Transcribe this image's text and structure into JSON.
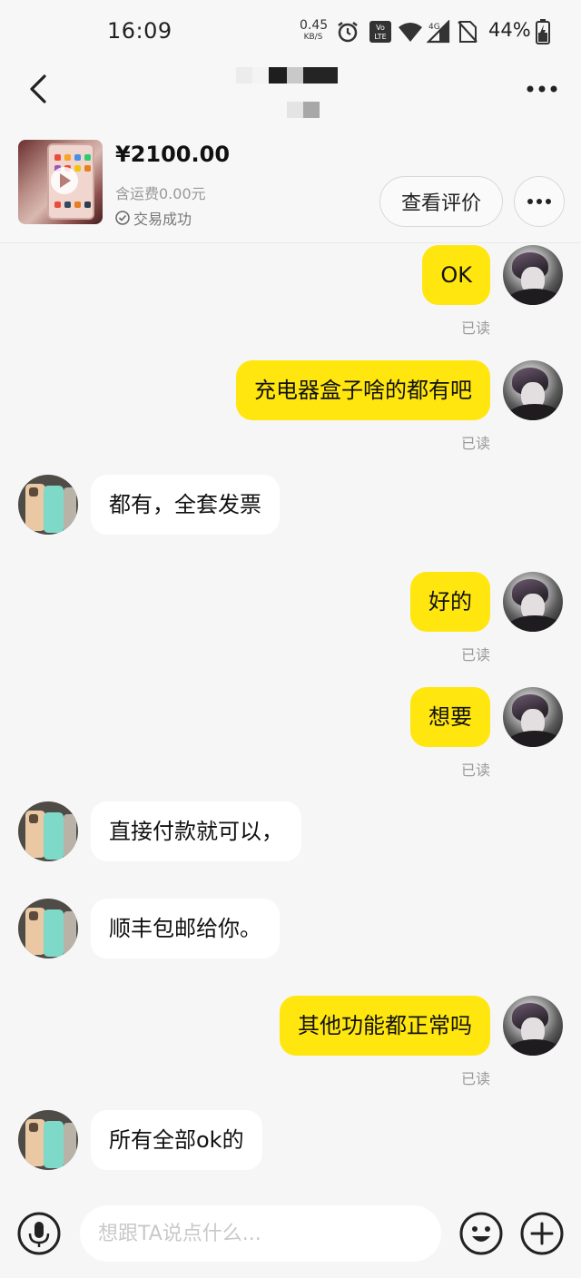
{
  "status_bar": {
    "time": "16:09",
    "net_speed": "0.45",
    "net_unit": "KB/S",
    "volte": "Vo LTE",
    "signal_label": "4G",
    "battery_percent": "44%"
  },
  "header": {
    "back_icon": "chevron-left-icon",
    "more_icon": "ellipsis-icon"
  },
  "product": {
    "price": "¥2100.00",
    "shipping": "含运费0.00元",
    "status": "交易成功",
    "review_button": "查看评价"
  },
  "messages": [
    {
      "side": "me",
      "text": "OK",
      "read": "已读"
    },
    {
      "side": "me",
      "text": "充电器盒子啥的都有吧",
      "read": "已读"
    },
    {
      "side": "other",
      "text": "都有，全套发票"
    },
    {
      "side": "me",
      "text": "好的",
      "read": "已读"
    },
    {
      "side": "me",
      "text": "想要",
      "read": "已读"
    },
    {
      "side": "other",
      "text": "直接付款就可以，"
    },
    {
      "side": "other",
      "text": "顺丰包邮给你。"
    },
    {
      "side": "me",
      "text": "其他功能都正常吗",
      "read": "已读"
    },
    {
      "side": "other",
      "text": "所有全部ok的"
    }
  ],
  "input_bar": {
    "placeholder": "想跟TA说点什么...",
    "mic_icon": "microphone-icon",
    "emoji_icon": "smiley-icon",
    "plus_icon": "plus-icon"
  },
  "colors": {
    "my_bubble": "#ffe60f",
    "other_bubble": "#ffffff",
    "background": "#f6f6f6"
  }
}
